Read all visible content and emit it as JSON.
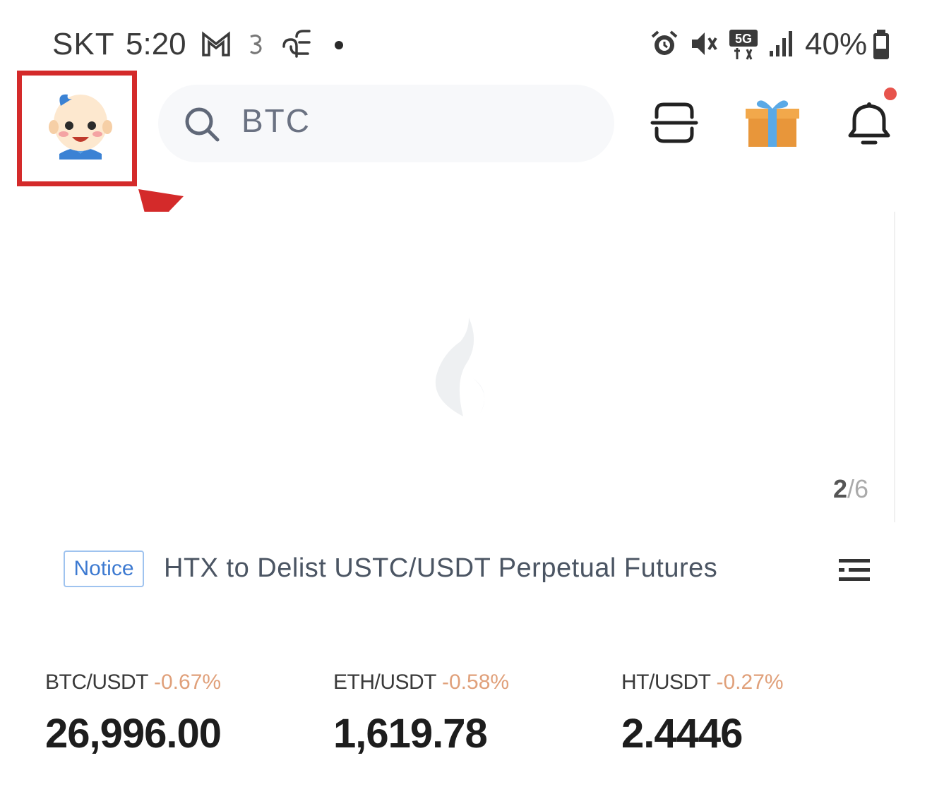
{
  "status_bar": {
    "carrier": "SKT",
    "time": "5:20",
    "battery": "40%"
  },
  "search": {
    "value": "BTC"
  },
  "banner": {
    "page_current": "2",
    "page_total": "/6"
  },
  "notice": {
    "tag": "Notice",
    "text": "HTX to Delist USTC/USDT Perpetual Futures"
  },
  "tickers": [
    {
      "pair": "BTC/USDT",
      "change": "-0.67%",
      "price": "26,996.00"
    },
    {
      "pair": "ETH/USDT",
      "change": "-0.58%",
      "price": "1,619.78"
    },
    {
      "pair": "HT/USDT",
      "change": "-0.27%",
      "price": "2.4446"
    }
  ],
  "colors": {
    "highlight": "#d42a2a",
    "negative_change": "#e0a07a",
    "notice_blue": "#3d7ad1",
    "notification_dot": "#e7544c"
  },
  "icons": {
    "scan": "scan-icon",
    "gift": "gift-icon",
    "notifications": "bell-icon",
    "notice_menu": "list-icon"
  }
}
